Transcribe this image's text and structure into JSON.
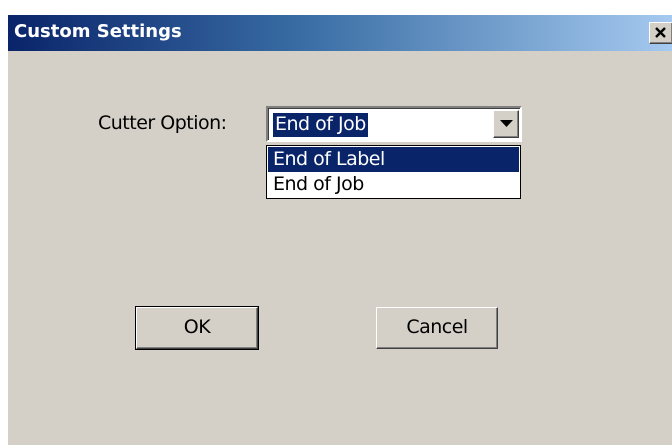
{
  "window": {
    "title": "Custom Settings",
    "close_glyph": "✕"
  },
  "form": {
    "cutter_label": "Cutter Option:",
    "cutter_value": "End of Job",
    "cutter_options": [
      {
        "label": "End of Label",
        "highlighted": true
      },
      {
        "label": "End of Job",
        "highlighted": false
      }
    ]
  },
  "buttons": {
    "ok": "OK",
    "cancel": "Cancel"
  },
  "colors": {
    "title_gradient_start": "#0a246a",
    "title_gradient_end": "#a6caf0",
    "dialog_face": "#d4d0c8",
    "selection": "#0a246a"
  },
  "icons": {
    "close": "close-icon",
    "dropdown": "chevron-down-icon"
  }
}
